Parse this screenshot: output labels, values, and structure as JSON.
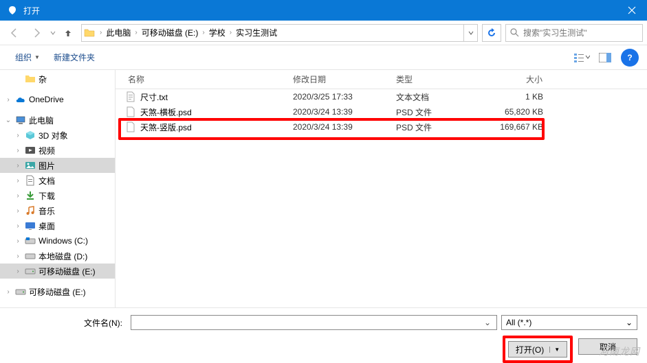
{
  "titlebar": {
    "title": "打开"
  },
  "breadcrumb": {
    "items": [
      "此电脑",
      "可移动磁盘 (E:)",
      "学校",
      "实习生测试"
    ]
  },
  "search": {
    "placeholder": "搜索\"实习生测试\""
  },
  "toolbar": {
    "organize": "组织",
    "new_folder": "新建文件夹"
  },
  "sidebar": {
    "items": [
      {
        "label": "杂",
        "icon": "folder",
        "indent": 1,
        "exp": ""
      },
      {
        "label": "",
        "icon": "",
        "indent": 0,
        "exp": "",
        "blank": true
      },
      {
        "label": "OneDrive",
        "icon": "onedrive",
        "indent": 0,
        "exp": ">"
      },
      {
        "label": "",
        "icon": "",
        "indent": 0,
        "exp": "",
        "blank": true
      },
      {
        "label": "此电脑",
        "icon": "pc",
        "indent": 0,
        "exp": "v"
      },
      {
        "label": "3D 对象",
        "icon": "3d",
        "indent": 1,
        "exp": ">"
      },
      {
        "label": "视频",
        "icon": "video",
        "indent": 1,
        "exp": ">"
      },
      {
        "label": "图片",
        "icon": "pictures",
        "indent": 1,
        "exp": ">",
        "selected": true
      },
      {
        "label": "文档",
        "icon": "docs",
        "indent": 1,
        "exp": ">"
      },
      {
        "label": "下载",
        "icon": "downloads",
        "indent": 1,
        "exp": ">"
      },
      {
        "label": "音乐",
        "icon": "music",
        "indent": 1,
        "exp": ">"
      },
      {
        "label": "桌面",
        "icon": "desktop",
        "indent": 1,
        "exp": ">"
      },
      {
        "label": "Windows (C:)",
        "icon": "drive-win",
        "indent": 1,
        "exp": ">"
      },
      {
        "label": "本地磁盘 (D:)",
        "icon": "drive",
        "indent": 1,
        "exp": ">"
      },
      {
        "label": "可移动磁盘 (E:)",
        "icon": "drive-usb",
        "indent": 1,
        "exp": ">",
        "selected": true
      },
      {
        "label": "",
        "icon": "",
        "indent": 0,
        "exp": "",
        "blank": true
      },
      {
        "label": "可移动磁盘 (E:)",
        "icon": "drive-usb",
        "indent": 0,
        "exp": ">"
      }
    ]
  },
  "filelist": {
    "headers": {
      "name": "名称",
      "date": "修改日期",
      "type": "类型",
      "size": "大小"
    },
    "rows": [
      {
        "name": "尺寸.txt",
        "date": "2020/3/25 17:33",
        "type": "文本文档",
        "size": "1 KB",
        "icon": "txt"
      },
      {
        "name": "天煞-横板.psd",
        "date": "2020/3/24 13:39",
        "type": "PSD 文件",
        "size": "65,820 KB",
        "icon": "psd"
      },
      {
        "name": "天煞-竖版.psd",
        "date": "2020/3/24 13:39",
        "type": "PSD 文件",
        "size": "169,667 KB",
        "icon": "psd"
      }
    ]
  },
  "footer": {
    "filename_label": "文件名(N):",
    "filename_value": "",
    "filter": "All (*.*)",
    "open": "打开(O)",
    "cancel": "取消"
  },
  "watermark": "河南龙网"
}
